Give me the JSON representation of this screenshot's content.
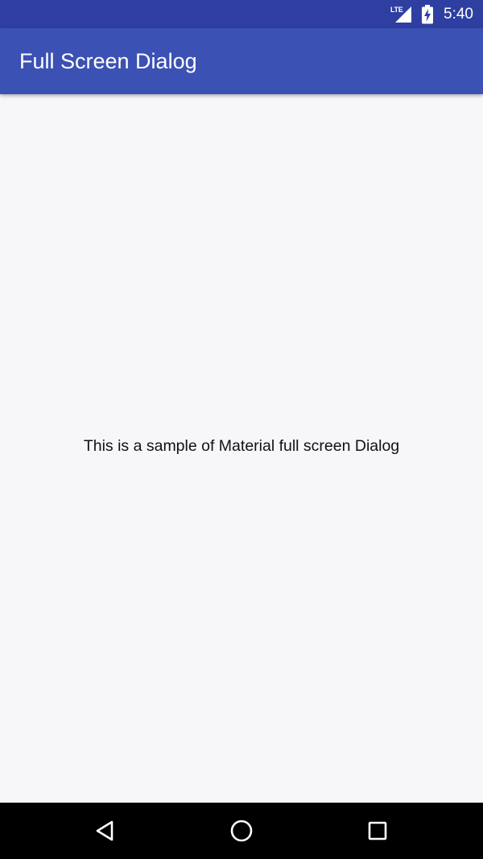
{
  "status_bar": {
    "network_label": "LTE",
    "time": "5:40",
    "signal_icon": "cell-signal-icon",
    "battery_icon": "battery-charging-icon"
  },
  "app_bar": {
    "title": "Full Screen Dialog",
    "color": "#3b51b4"
  },
  "content": {
    "message": "This is a sample of Material full screen Dialog"
  },
  "nav_bar": {
    "back_icon": "back-triangle-icon",
    "home_icon": "home-circle-icon",
    "recents_icon": "recents-square-icon"
  },
  "colors": {
    "status_bar": "#2e3fa1",
    "app_bar": "#3b51b4",
    "background": "#f7f6f9",
    "nav_bar": "#000000"
  }
}
